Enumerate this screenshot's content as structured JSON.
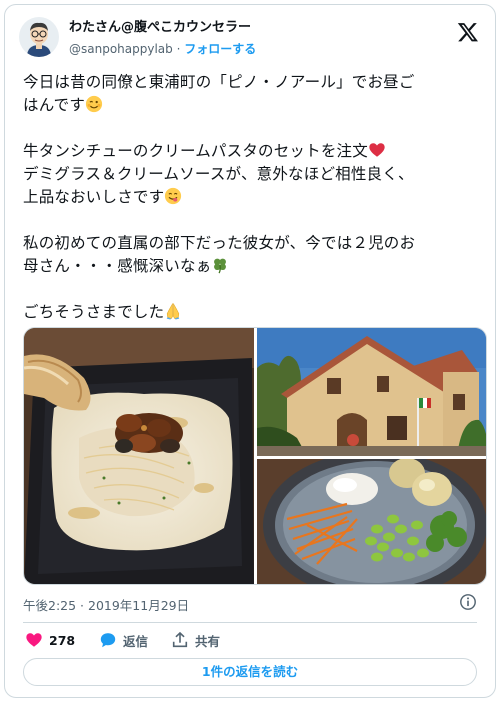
{
  "author": {
    "display_name": "わたさん@腹ぺこカウンセラー",
    "handle": "@sanpohappylab",
    "separator": " · ",
    "follow_label": "フォローする"
  },
  "tweet": {
    "lines": [
      "今日は昔の同僚と東浦町の「ピノ・ノアール」でお昼ご",
      "はんです",
      "",
      "牛タンシチューのクリームパスタのセットを注文",
      "デミグラス＆クリームソースが、意外なほど相性良く、",
      "上品なおいしさです",
      "",
      "私の初めての直属の部下だった彼女が、今では２児のお",
      "母さん・・・感慨深いなぁ",
      "",
      "ごちそうさまでした"
    ]
  },
  "media": {
    "photos": [
      "pasta-photo",
      "restaurant-building-photo",
      "salad-photo"
    ]
  },
  "timestamp": "午後2:25 · 2019年11月29日",
  "actions": {
    "likes": "278",
    "reply_label": "返信",
    "share_label": "共有"
  },
  "read_replies_label": "1件の返信を読む",
  "icons": {
    "logo": "x-logo-icon",
    "info": "info-icon",
    "like": "heart-icon",
    "reply": "speech-bubble-icon",
    "share": "share-icon"
  },
  "colors": {
    "link": "#1d9bf0",
    "like": "#f91880",
    "text": "#0f1419",
    "secondary": "#536471"
  }
}
